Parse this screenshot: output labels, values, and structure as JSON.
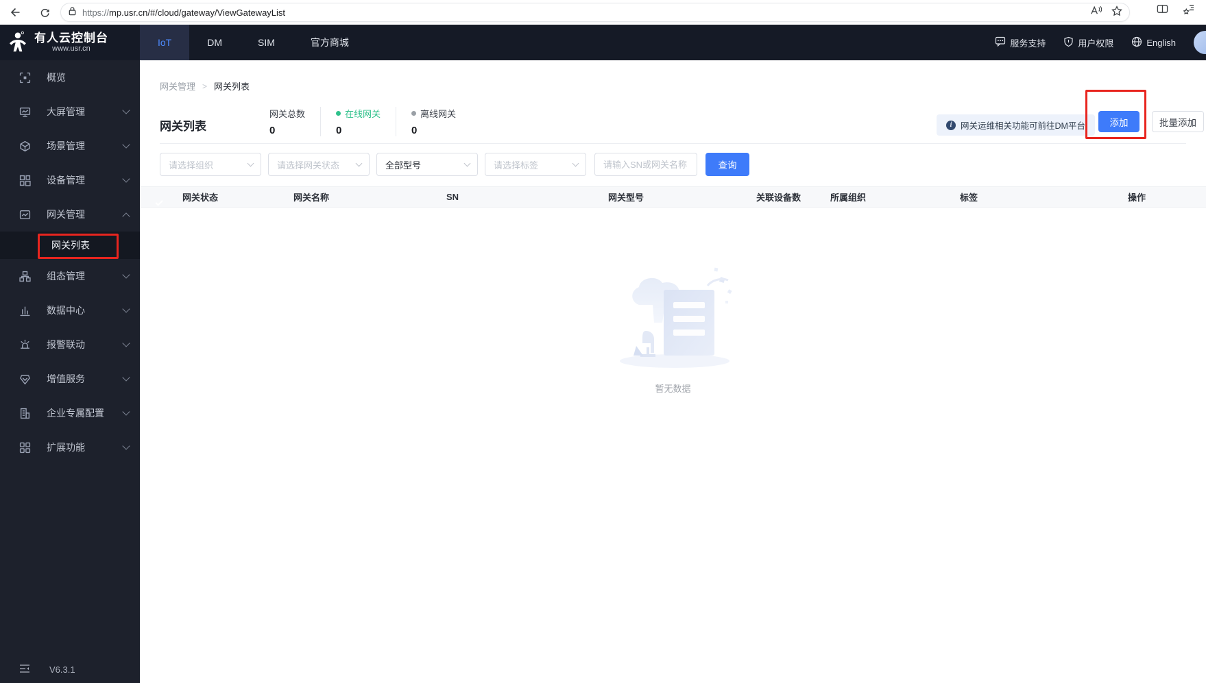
{
  "browser": {
    "url_scheme": "https://",
    "url_rest": "mp.usr.cn/#/cloud/gateway/ViewGatewayList"
  },
  "header": {
    "logo_title": "有人云控制台",
    "logo_subtitle": "www.usr.cn",
    "nav": [
      {
        "label": "IoT",
        "active": true
      },
      {
        "label": "DM",
        "active": false
      },
      {
        "label": "SIM",
        "active": false
      },
      {
        "label": "官方商城",
        "active": false
      }
    ],
    "right": [
      {
        "label": "服务支持",
        "icon": "chat-icon"
      },
      {
        "label": "用户权限",
        "icon": "shield-icon"
      },
      {
        "label": "English",
        "icon": "globe-icon"
      }
    ]
  },
  "sidebar": {
    "items": [
      {
        "label": "概览",
        "icon": "overview-icon",
        "expandable": false
      },
      {
        "label": "大屏管理",
        "icon": "bigscreen-icon",
        "expandable": true
      },
      {
        "label": "场景管理",
        "icon": "scene-icon",
        "expandable": true
      },
      {
        "label": "设备管理",
        "icon": "device-icon",
        "expandable": true
      },
      {
        "label": "网关管理",
        "icon": "gateway-icon",
        "expandable": true,
        "expanded": true
      },
      {
        "label": "组态管理",
        "icon": "scada-icon",
        "expandable": true
      },
      {
        "label": "数据中心",
        "icon": "datacenter-icon",
        "expandable": true
      },
      {
        "label": "报警联动",
        "icon": "alarm-icon",
        "expandable": true
      },
      {
        "label": "增值服务",
        "icon": "vas-icon",
        "expandable": true
      },
      {
        "label": "企业专属配置",
        "icon": "enterprise-icon",
        "expandable": true
      },
      {
        "label": "扩展功能",
        "icon": "extension-icon",
        "expandable": true
      }
    ],
    "submenu_active": "网关列表",
    "version": "V6.3.1"
  },
  "breadcrumb": {
    "parent": "网关管理",
    "separator": ">",
    "current": "网关列表"
  },
  "page": {
    "title": "网关列表",
    "stats": [
      {
        "label": "网关总数",
        "value": "0",
        "dot": "none"
      },
      {
        "label": "在线网关",
        "value": "0",
        "dot": "green"
      },
      {
        "label": "离线网关",
        "value": "0",
        "dot": "gray"
      }
    ],
    "notice_text": "网关运维相关功能可前往DM平台",
    "add_button": "添加",
    "batch_add_button": "批量添加",
    "filters": {
      "org_placeholder": "请选择组织",
      "status_placeholder": "请选择网关状态",
      "model_value": "全部型号",
      "tag_placeholder": "请选择标签",
      "search_placeholder": "请输入SN或网关名称",
      "query_button": "查询"
    },
    "table_columns": [
      "网关状态",
      "网关名称",
      "SN",
      "网关型号",
      "关联设备数",
      "所属组织",
      "标签",
      "操作"
    ],
    "empty_text": "暂无数据"
  },
  "colors": {
    "accent_blue": "#3e7bfa",
    "nav_active_blue": "#4d8bff",
    "online_green": "#2fc18b",
    "offline_gray": "#9aa0a6",
    "annotation_red": "#e8251f",
    "header_bg": "#151a26",
    "sidebar_bg": "#1d212c"
  }
}
